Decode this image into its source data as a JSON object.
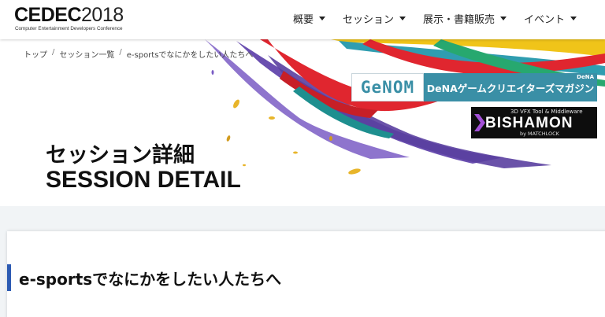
{
  "header": {
    "logo": {
      "main_bold": "CEDEC",
      "main_year": "2018",
      "sub": "Computer Entertainment Developers Conference"
    },
    "nav": [
      {
        "label": "概要"
      },
      {
        "label": "セッション"
      },
      {
        "label": "展示・書籍販売"
      },
      {
        "label": "イベント"
      }
    ]
  },
  "breadcrumb": [
    "トップ",
    "セッション一覧",
    "e-sportsでなにかをしたい人たちへ"
  ],
  "sponsors": {
    "genom": "GeNOM",
    "dena": "DeNAゲームクリエイターズマガジン",
    "dena_badge": "DeNA",
    "bishamon_top": "3D VFX Tool & Middleware",
    "bishamon": "BISHAMON",
    "bishamon_by": "by MATCHLOCK"
  },
  "page_title": {
    "jp": "セッション詳細",
    "en": "SESSION DETAIL"
  },
  "session": {
    "title": "e-sportsでなにかをしたい人たちへ"
  },
  "colors": {
    "accent_blue": "#2d5bb3",
    "teal": "#3a8fa6",
    "purple": "#6a4fb0",
    "red": "#e0262f",
    "yellow": "#f0c419"
  }
}
